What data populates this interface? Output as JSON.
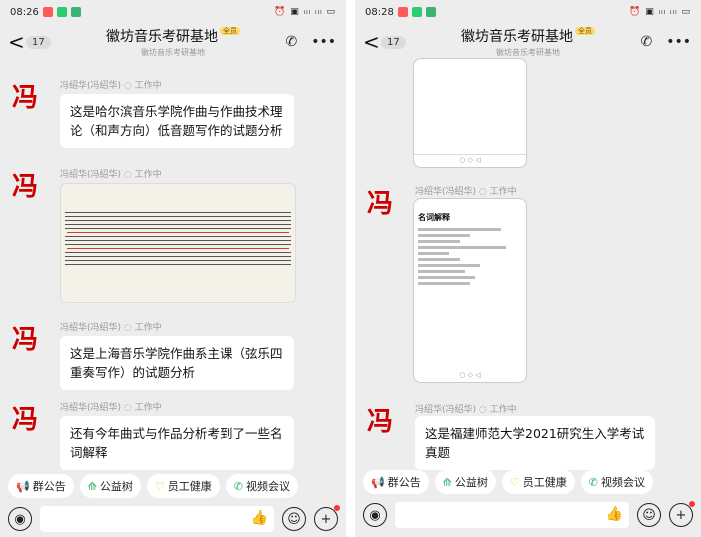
{
  "left": {
    "status": {
      "time": "08:26",
      "icons": "⏰ ▣ ᵢₗₗ ᵢₗₗ ▭"
    },
    "header": {
      "back": "<",
      "count": "17",
      "title": "徽坊音乐考研基地",
      "tag": "全员",
      "subtitle": "徽坊音乐考研基地"
    },
    "messages": [
      {
        "sender": "冯绍华(冯绍华) ◌ 工作中",
        "text": "这是哈尔滨音乐学院作曲与作曲技术理论（和声方向）低音题写作的试题分析"
      },
      {
        "sender": "冯绍华(冯绍华) ◌ 工作中",
        "text": ""
      },
      {
        "sender": "冯绍华(冯绍华) ◌ 工作中",
        "text": "这是上海音乐学院作曲系主课（弦乐四重奏写作）的试题分析"
      },
      {
        "sender": "冯绍华(冯绍华) ◌ 工作中",
        "text": "还有今年曲式与作品分析考到了一些名词解释"
      }
    ],
    "chips": [
      "群公告",
      "公益树",
      "员工健康",
      "视频会议"
    ]
  },
  "right": {
    "status": {
      "time": "08:28",
      "icons": "⏰ ▣ ᵢₗₗ ᵢₗₗ ▭"
    },
    "header": {
      "back": "<",
      "count": "17",
      "title": "徽坊音乐考研基地",
      "tag": "全员",
      "subtitle": "徽坊音乐考研基地"
    },
    "messages": [
      {
        "sender": "冯绍华(冯绍华) ◌ 工作中",
        "text": ""
      },
      {
        "sender": "冯绍华(冯绍华) ◌ 工作中",
        "text": "这是福建师范大学2021研究生入学考试真题"
      }
    ],
    "doc_title": "名词解释",
    "chips": [
      "群公告",
      "公益树",
      "员工健康",
      "视频会议"
    ]
  },
  "avatar_char": "冯",
  "colors": {
    "background": "#ededed",
    "bubble": "#ffffff",
    "accent": "#c00000"
  }
}
